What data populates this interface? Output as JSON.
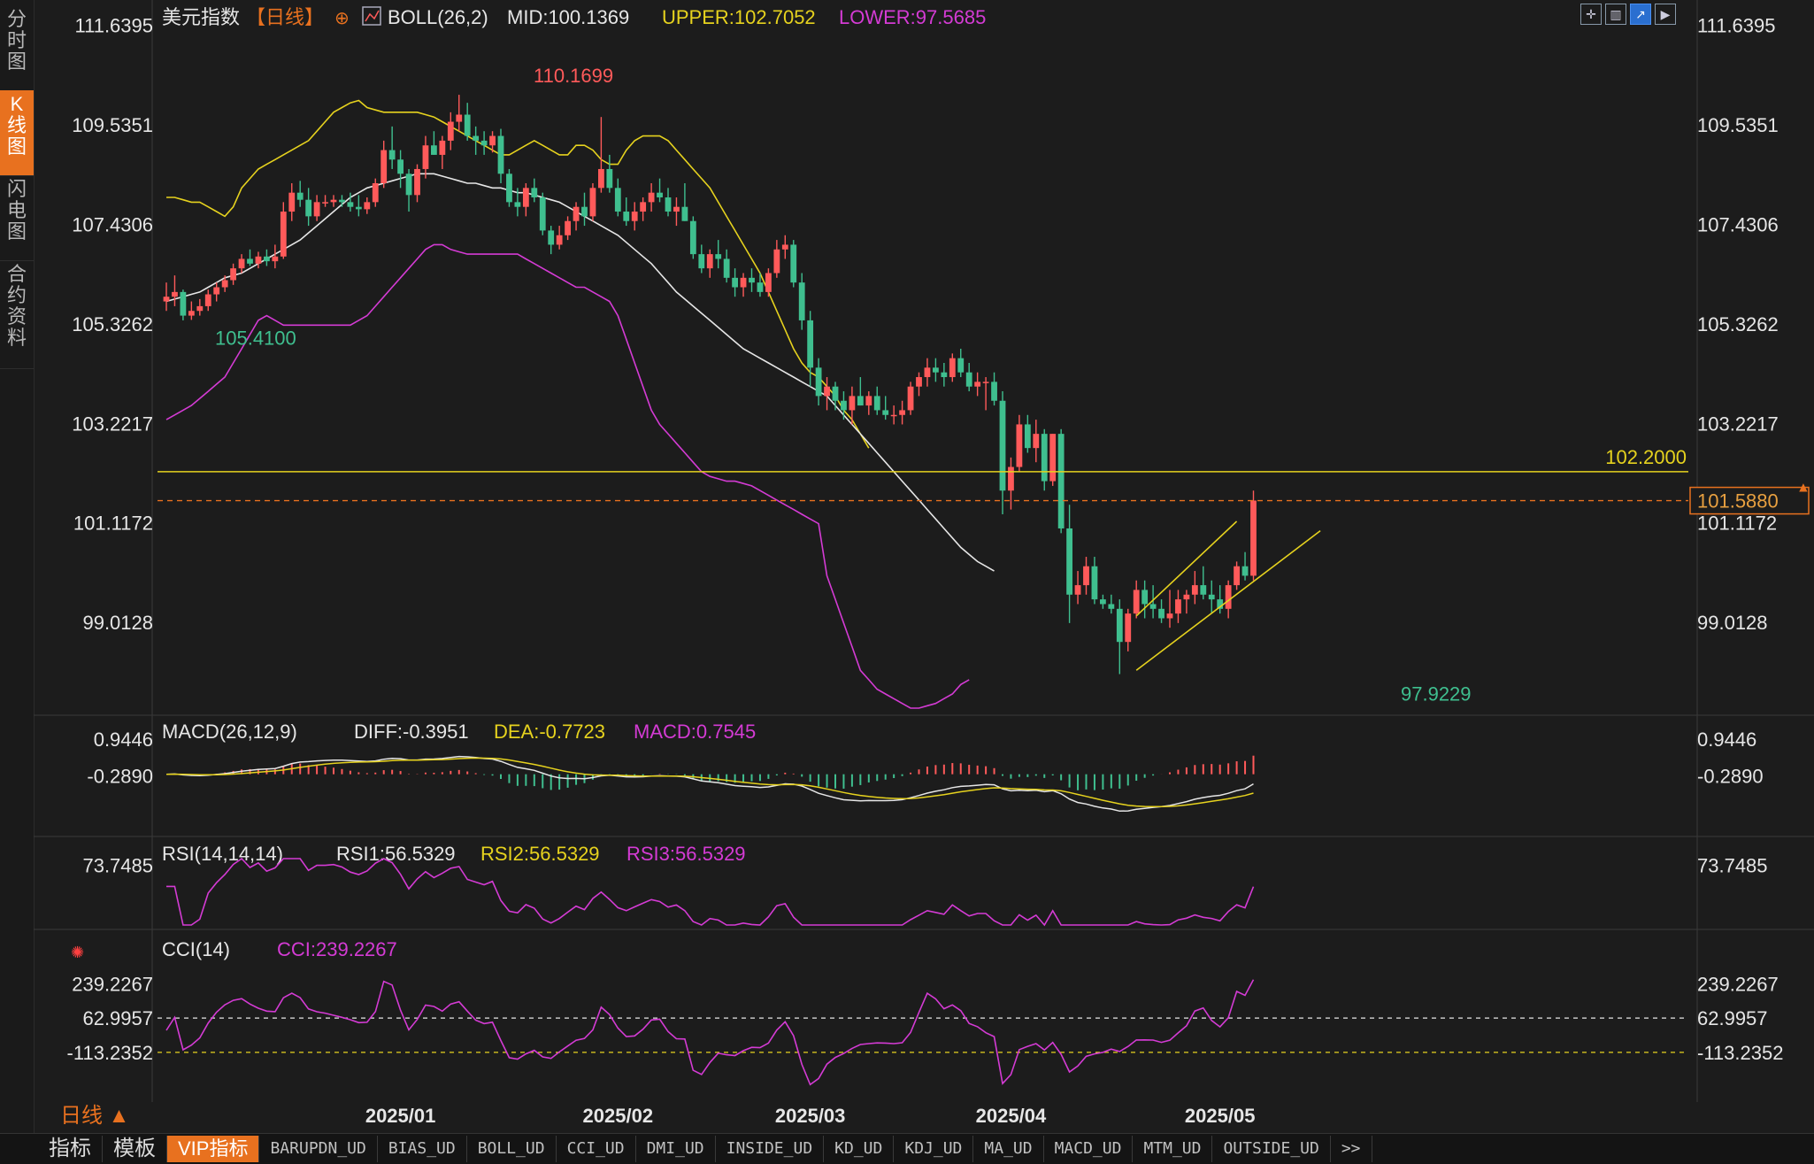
{
  "sidebar": {
    "tabs": [
      {
        "label": "分时图",
        "active": false
      },
      {
        "label": "K线图",
        "active": true
      },
      {
        "label": "闪电图",
        "active": false
      },
      {
        "label": "合约资料",
        "active": false
      }
    ]
  },
  "header": {
    "instrument": "美元指数",
    "period_label": "【日线】",
    "boll_label": "BOLL(26,2)",
    "mid": "MID:100.1369",
    "upper": "UPPER:102.7052",
    "lower": "LOWER:97.5685"
  },
  "period_selector": "日线 ▲",
  "bottom_tabs": [
    "指标",
    "模板",
    "VIP指标",
    "BARUPDN_UD",
    "BIAS_UD",
    "BOLL_UD",
    "CCI_UD",
    "DMI_UD",
    "INSIDE_UD",
    "KD_UD",
    "KDJ_UD",
    "MA_UD",
    "MACD_UD",
    "MTM_UD",
    "OUTSIDE_UD",
    ">>"
  ],
  "colors": {
    "up": "#ff5a5a",
    "down": "#3fbf8f",
    "mid": "#e6e6e6",
    "upper": "#e6d21e",
    "lower": "#d43bd4",
    "accent": "#e8711f"
  },
  "chart_data": {
    "type": "candlestick",
    "y_ticks": [
      "111.6395",
      "109.5351",
      "107.4306",
      "105.3262",
      "103.2217",
      "101.1172",
      "99.0128"
    ],
    "ylim": [
      97.2,
      111.8
    ],
    "x_ticks": [
      "2025/01",
      "2025/02",
      "2025/03",
      "2025/04",
      "2025/05"
    ],
    "annotations": {
      "high_label": "110.1699",
      "high_value": 110.1699,
      "low_label": "105.4100",
      "low_value": 105.41,
      "low2_label": "97.9229",
      "low2_value": 97.9229,
      "hline_label": "102.2000",
      "hline_value": 102.2,
      "last_price_label": "101.5880",
      "last_price_value": 101.588
    },
    "candles": [
      [
        105.8,
        106.2,
        105.6,
        105.9
      ],
      [
        105.9,
        106.35,
        105.7,
        106.0
      ],
      [
        106.0,
        106.05,
        105.4,
        105.5
      ],
      [
        105.5,
        105.8,
        105.41,
        105.6
      ],
      [
        105.6,
        105.85,
        105.5,
        105.7
      ],
      [
        105.7,
        106.05,
        105.6,
        105.95
      ],
      [
        105.95,
        106.2,
        105.8,
        106.1
      ],
      [
        106.1,
        106.35,
        106.0,
        106.25
      ],
      [
        106.25,
        106.6,
        106.15,
        106.5
      ],
      [
        106.5,
        106.8,
        106.4,
        106.7
      ],
      [
        106.7,
        106.9,
        106.55,
        106.6
      ],
      [
        106.6,
        106.85,
        106.5,
        106.75
      ],
      [
        106.75,
        106.9,
        106.55,
        106.65
      ],
      [
        106.65,
        107.0,
        106.5,
        106.75
      ],
      [
        106.75,
        107.9,
        106.7,
        107.7
      ],
      [
        107.7,
        108.3,
        107.5,
        108.1
      ],
      [
        108.1,
        108.35,
        107.8,
        107.95
      ],
      [
        107.95,
        108.2,
        107.4,
        107.6
      ],
      [
        107.6,
        108.05,
        107.5,
        107.9
      ],
      [
        107.9,
        108.05,
        107.8,
        107.9
      ],
      [
        107.9,
        108.05,
        107.8,
        107.95
      ],
      [
        107.95,
        108.05,
        107.8,
        107.9
      ],
      [
        107.9,
        108.1,
        107.7,
        107.8
      ],
      [
        107.8,
        108.05,
        107.6,
        107.75
      ],
      [
        107.75,
        108.0,
        107.65,
        107.9
      ],
      [
        107.9,
        108.4,
        107.8,
        108.3
      ],
      [
        108.3,
        109.2,
        108.2,
        109.0
      ],
      [
        109.0,
        109.5,
        108.6,
        108.8
      ],
      [
        108.8,
        109.0,
        108.2,
        108.5
      ],
      [
        108.5,
        108.6,
        107.7,
        108.05
      ],
      [
        108.05,
        108.7,
        107.9,
        108.6
      ],
      [
        108.6,
        109.3,
        108.4,
        109.1
      ],
      [
        109.1,
        109.4,
        108.9,
        108.9
      ],
      [
        108.9,
        109.3,
        108.6,
        109.2
      ],
      [
        109.2,
        109.8,
        109.0,
        109.6
      ],
      [
        109.6,
        110.17,
        109.4,
        109.75
      ],
      [
        109.75,
        110.0,
        109.2,
        109.3
      ],
      [
        109.3,
        109.5,
        108.9,
        109.2
      ],
      [
        109.2,
        109.4,
        108.9,
        109.1
      ],
      [
        109.1,
        109.4,
        108.95,
        109.3
      ],
      [
        109.3,
        109.45,
        108.3,
        108.5
      ],
      [
        108.5,
        108.6,
        107.8,
        107.9
      ],
      [
        107.9,
        108.2,
        107.6,
        107.8
      ],
      [
        107.8,
        108.3,
        107.6,
        108.2
      ],
      [
        108.2,
        108.4,
        107.9,
        108.0
      ],
      [
        108.0,
        108.1,
        107.2,
        107.3
      ],
      [
        107.3,
        107.4,
        106.8,
        107.0
      ],
      [
        107.0,
        107.4,
        106.9,
        107.2
      ],
      [
        107.2,
        107.6,
        107.1,
        107.5
      ],
      [
        107.5,
        107.9,
        107.3,
        107.8
      ],
      [
        107.8,
        108.1,
        107.4,
        107.6
      ],
      [
        107.6,
        108.3,
        107.5,
        108.2
      ],
      [
        108.2,
        109.7,
        108.1,
        108.6
      ],
      [
        108.6,
        108.9,
        108.1,
        108.2
      ],
      [
        108.2,
        108.4,
        107.6,
        107.7
      ],
      [
        107.7,
        108.0,
        107.4,
        107.5
      ],
      [
        107.5,
        107.9,
        107.3,
        107.7
      ],
      [
        107.7,
        108.0,
        107.5,
        107.9
      ],
      [
        107.9,
        108.3,
        107.7,
        108.1
      ],
      [
        108.1,
        108.4,
        107.9,
        108.0
      ],
      [
        108.0,
        108.2,
        107.6,
        107.7
      ],
      [
        107.7,
        108.0,
        107.4,
        107.8
      ],
      [
        107.8,
        108.3,
        107.5,
        107.5
      ],
      [
        107.5,
        107.6,
        106.7,
        106.8
      ],
      [
        106.8,
        107.0,
        106.4,
        106.5
      ],
      [
        106.5,
        106.9,
        106.3,
        106.8
      ],
      [
        106.8,
        107.1,
        106.5,
        106.7
      ],
      [
        106.7,
        106.9,
        106.2,
        106.3
      ],
      [
        106.3,
        106.5,
        105.9,
        106.1
      ],
      [
        106.1,
        106.4,
        105.9,
        106.3
      ],
      [
        106.3,
        106.5,
        106.0,
        106.2
      ],
      [
        106.2,
        106.4,
        105.9,
        106.0
      ],
      [
        106.0,
        106.5,
        105.9,
        106.4
      ],
      [
        106.4,
        107.1,
        106.3,
        106.9
      ],
      [
        106.9,
        107.2,
        106.7,
        107.0
      ],
      [
        107.0,
        107.1,
        106.1,
        106.2
      ],
      [
        106.2,
        106.4,
        105.2,
        105.4
      ],
      [
        105.4,
        105.6,
        104.0,
        104.4
      ],
      [
        104.4,
        104.6,
        103.6,
        103.8
      ],
      [
        103.8,
        104.2,
        103.5,
        104.0
      ],
      [
        104.0,
        104.1,
        103.5,
        103.7
      ],
      [
        103.7,
        103.9,
        103.3,
        103.5
      ],
      [
        103.5,
        104.0,
        103.2,
        103.8
      ],
      [
        103.8,
        104.2,
        103.6,
        103.6
      ],
      [
        103.6,
        103.9,
        103.4,
        103.8
      ],
      [
        103.8,
        104.0,
        103.4,
        103.5
      ],
      [
        103.5,
        103.8,
        103.3,
        103.4
      ],
      [
        103.4,
        103.6,
        103.2,
        103.4
      ],
      [
        103.4,
        103.7,
        103.2,
        103.5
      ],
      [
        103.5,
        104.1,
        103.4,
        104.0
      ],
      [
        104.0,
        104.3,
        103.8,
        104.2
      ],
      [
        104.2,
        104.6,
        104.0,
        104.4
      ],
      [
        104.4,
        104.6,
        104.1,
        104.3
      ],
      [
        104.3,
        104.5,
        104.0,
        104.2
      ],
      [
        104.2,
        104.7,
        104.1,
        104.6
      ],
      [
        104.6,
        104.8,
        104.2,
        104.3
      ],
      [
        104.3,
        104.5,
        103.9,
        104.0
      ],
      [
        104.0,
        104.3,
        103.8,
        104.1
      ],
      [
        104.1,
        104.2,
        103.5,
        104.1
      ],
      [
        104.1,
        104.3,
        103.6,
        103.7
      ],
      [
        103.7,
        103.9,
        101.3,
        101.8
      ],
      [
        101.8,
        102.5,
        101.4,
        102.3
      ],
      [
        102.3,
        103.4,
        102.2,
        103.2
      ],
      [
        103.2,
        103.4,
        102.6,
        102.7
      ],
      [
        102.7,
        103.3,
        102.4,
        103.0
      ],
      [
        103.0,
        103.1,
        101.8,
        102.0
      ],
      [
        102.0,
        103.0,
        101.9,
        103.0
      ],
      [
        103.0,
        103.1,
        100.9,
        101.0
      ],
      [
        101.0,
        101.5,
        99.0,
        99.6
      ],
      [
        99.6,
        100.1,
        99.4,
        99.8
      ],
      [
        99.8,
        100.4,
        99.6,
        100.2
      ],
      [
        100.2,
        100.4,
        99.4,
        99.5
      ],
      [
        99.5,
        99.6,
        99.3,
        99.4
      ],
      [
        99.4,
        99.6,
        99.2,
        99.3
      ],
      [
        99.3,
        99.5,
        97.92,
        98.6
      ],
      [
        98.6,
        99.3,
        98.4,
        99.2
      ],
      [
        99.2,
        99.9,
        99.1,
        99.7
      ],
      [
        99.7,
        99.9,
        99.1,
        99.4
      ],
      [
        99.4,
        99.8,
        99.1,
        99.3
      ],
      [
        99.3,
        99.5,
        99.0,
        99.1
      ],
      [
        99.1,
        99.7,
        98.9,
        99.2
      ],
      [
        99.2,
        99.7,
        99.0,
        99.5
      ],
      [
        99.5,
        99.7,
        99.2,
        99.6
      ],
      [
        99.6,
        100.1,
        99.4,
        99.8
      ],
      [
        99.8,
        100.2,
        99.5,
        99.6
      ],
      [
        99.6,
        99.9,
        99.2,
        99.5
      ],
      [
        99.5,
        99.8,
        99.2,
        99.3
      ],
      [
        99.3,
        99.9,
        99.1,
        99.8
      ],
      [
        99.8,
        100.3,
        99.7,
        100.2
      ],
      [
        100.2,
        100.5,
        99.9,
        100.0
      ],
      [
        100.0,
        101.8,
        99.9,
        101.59
      ]
    ],
    "boll": {
      "upper": [
        108.0,
        108.0,
        107.95,
        107.9,
        107.9,
        107.8,
        107.7,
        107.6,
        107.8,
        108.2,
        108.4,
        108.6,
        108.7,
        108.8,
        108.9,
        109.0,
        109.1,
        109.2,
        109.4,
        109.6,
        109.8,
        109.9,
        110.0,
        110.05,
        109.9,
        109.85,
        109.8,
        109.8,
        109.8,
        109.8,
        109.8,
        109.75,
        109.7,
        109.6,
        109.5,
        109.4,
        109.3,
        109.2,
        109.1,
        109.0,
        108.9,
        108.9,
        109.0,
        109.1,
        109.2,
        109.1,
        109.0,
        108.9,
        108.9,
        109.1,
        109.1,
        109.0,
        108.8,
        108.7,
        108.7,
        109.0,
        109.2,
        109.3,
        109.3,
        109.3,
        109.2,
        109.0,
        108.8,
        108.6,
        108.4,
        108.2,
        107.9,
        107.6,
        107.3,
        107.0,
        106.7,
        106.4,
        106.0,
        105.6,
        105.2,
        104.8,
        104.5,
        104.3,
        104.2,
        104.0,
        103.8,
        103.5,
        103.3,
        103.0,
        102.7
      ],
      "upper_start": 0,
      "mid": [
        105.8,
        105.85,
        105.9,
        105.95,
        106.0,
        106.1,
        106.2,
        106.3,
        106.35,
        106.4,
        106.5,
        106.6,
        106.7,
        106.8,
        106.9,
        107.0,
        107.1,
        107.25,
        107.4,
        107.55,
        107.7,
        107.85,
        108.0,
        108.1,
        108.2,
        108.25,
        108.3,
        108.35,
        108.4,
        108.45,
        108.5,
        108.5,
        108.5,
        108.45,
        108.4,
        108.35,
        108.3,
        108.3,
        108.25,
        108.2,
        108.2,
        108.15,
        108.1,
        108.1,
        108.05,
        108.0,
        107.95,
        107.9,
        107.8,
        107.7,
        107.6,
        107.5,
        107.4,
        107.3,
        107.2,
        107.05,
        106.9,
        106.75,
        106.6,
        106.4,
        106.2,
        106.0,
        105.85,
        105.7,
        105.55,
        105.4,
        105.25,
        105.1,
        104.95,
        104.8,
        104.7,
        104.6,
        104.5,
        104.4,
        104.3,
        104.2,
        104.1,
        104.0,
        103.9,
        103.8,
        103.6,
        103.4,
        103.2,
        103.0,
        102.8,
        102.6,
        102.4,
        102.2,
        102.0,
        101.8,
        101.6,
        101.4,
        101.2,
        101.0,
        100.8,
        100.6,
        100.45,
        100.3,
        100.2,
        100.1
      ],
      "lower": [
        103.3,
        103.4,
        103.5,
        103.6,
        103.75,
        103.9,
        104.05,
        104.2,
        104.5,
        104.8,
        105.1,
        105.4,
        105.5,
        105.4,
        105.3,
        105.3,
        105.3,
        105.3,
        105.3,
        105.3,
        105.3,
        105.3,
        105.3,
        105.4,
        105.5,
        105.7,
        105.9,
        106.1,
        106.3,
        106.5,
        106.7,
        106.9,
        107.0,
        107.0,
        106.9,
        106.85,
        106.8,
        106.8,
        106.8,
        106.8,
        106.8,
        106.8,
        106.8,
        106.7,
        106.6,
        106.5,
        106.4,
        106.3,
        106.2,
        106.1,
        106.1,
        106.0,
        105.9,
        105.8,
        105.5,
        105.0,
        104.5,
        104.0,
        103.5,
        103.2,
        103.0,
        102.8,
        102.6,
        102.4,
        102.2,
        102.1,
        102.05,
        102.0,
        102.0,
        101.95,
        101.9,
        101.8,
        101.7,
        101.6,
        101.5,
        101.4,
        101.3,
        101.2,
        101.1,
        100.0,
        99.5,
        99.0,
        98.5,
        98.0,
        97.8,
        97.6,
        97.5,
        97.4,
        97.3,
        97.2,
        97.2,
        97.25,
        97.3,
        97.4,
        97.5,
        97.7,
        97.8
      ]
    },
    "channel": {
      "upper": [
        [
          116,
          99.15
        ],
        [
          128,
          101.15
        ]
      ],
      "lower": [
        [
          116,
          98.0
        ],
        [
          138,
          100.95
        ]
      ]
    },
    "macd": {
      "label": "MACD(26,12,9)",
      "diff_label": "DIFF:-0.3951",
      "dea_label": "DEA:-0.7723",
      "macd_label": "MACD:0.7545",
      "y_ticks": [
        "0.9446",
        "-0.2890"
      ],
      "ylim": [
        -2.2,
        1.1
      ]
    },
    "rsi": {
      "label": "RSI(14,14,14)",
      "rsi1_label": "RSI1:56.5329",
      "rsi2_label": "RSI2:56.5329",
      "rsi3_label": "RSI3:56.5329",
      "y_ticks": [
        "73.7485"
      ],
      "ylim": [
        35,
        78
      ]
    },
    "cci": {
      "label": "CCI(14)",
      "cci_label": "CCI:239.2267",
      "y_ticks": [
        "239.2267",
        "62.9957",
        "-113.2352"
      ],
      "ylim": [
        -300,
        300
      ],
      "levels": [
        62.9957,
        -113.2352
      ]
    }
  }
}
